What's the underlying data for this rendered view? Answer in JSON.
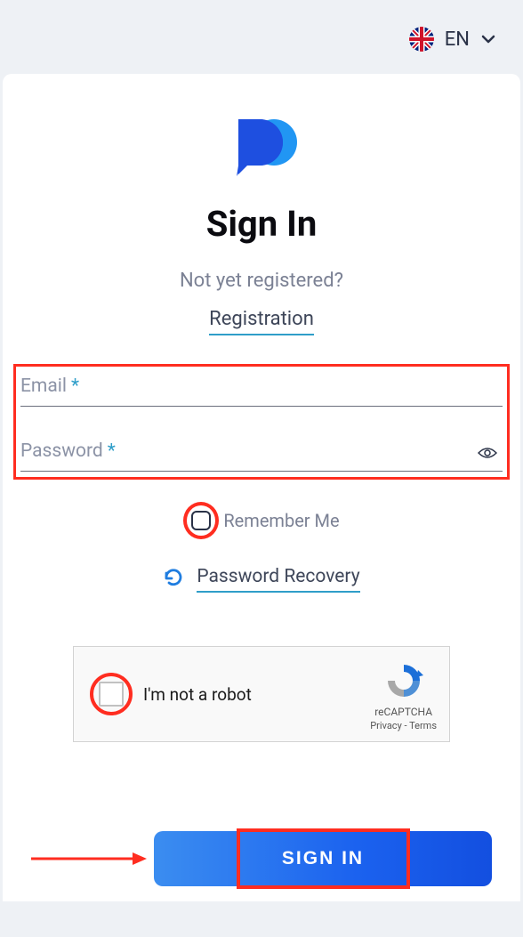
{
  "header": {
    "language": "EN"
  },
  "page": {
    "title": "Sign In",
    "subtitle": "Not yet registered?",
    "registration_link": "Registration",
    "email_label": "Email",
    "password_label": "Password",
    "remember_label": "Remember Me",
    "recovery_label": "Password Recovery",
    "captcha_label": "I'm not a robot",
    "captcha_brand": "reCAPTCHA",
    "captcha_privacy": "Privacy",
    "captcha_terms": "Terms",
    "signin_button": "SIGN IN"
  }
}
